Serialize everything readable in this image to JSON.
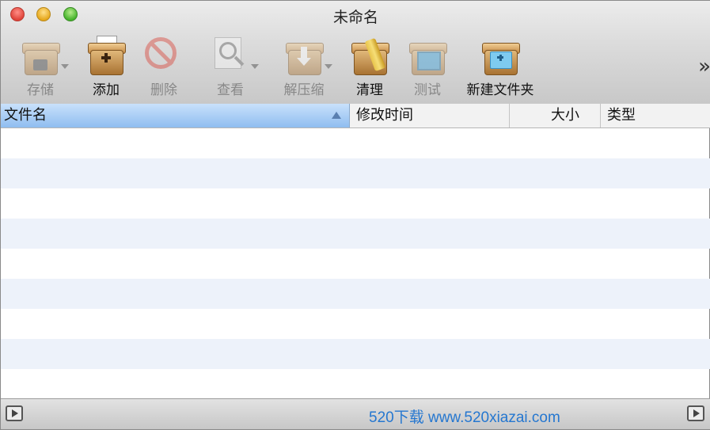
{
  "window": {
    "title": "未命名"
  },
  "toolbar": [
    {
      "id": "store",
      "label": "存储",
      "icon": "archive-box-icon",
      "enabled": false,
      "has_menu": true
    },
    {
      "id": "add",
      "label": "添加",
      "icon": "add-box-icon",
      "enabled": true,
      "has_menu": false
    },
    {
      "id": "delete",
      "label": "删除",
      "icon": "no-entry-icon",
      "enabled": false,
      "has_menu": false
    },
    {
      "id": "view",
      "label": "查看",
      "icon": "magnifier-icon",
      "enabled": false,
      "has_menu": true
    },
    {
      "id": "extract",
      "label": "解压缩",
      "icon": "extract-arrow-box-icon",
      "enabled": false,
      "has_menu": true
    },
    {
      "id": "clean",
      "label": "清理",
      "icon": "broom-box-icon",
      "enabled": true,
      "has_menu": false
    },
    {
      "id": "test",
      "label": "测试",
      "icon": "checkmark-box-icon",
      "enabled": false,
      "has_menu": false
    },
    {
      "id": "newfolder",
      "label": "新建文件夹",
      "icon": "new-folder-box-icon",
      "enabled": true,
      "has_menu": false
    }
  ],
  "overflow": {
    "label": "»",
    "icon": "chevron-double-right-icon"
  },
  "columns": {
    "name": "文件名",
    "modified": "修改时间",
    "size": "大小",
    "kind": "类型"
  },
  "status": {
    "text": "520下载 www.520xiazai.com"
  },
  "colors": {
    "selected_header": "#8fbdf0",
    "stripe": "#edf2fa"
  }
}
